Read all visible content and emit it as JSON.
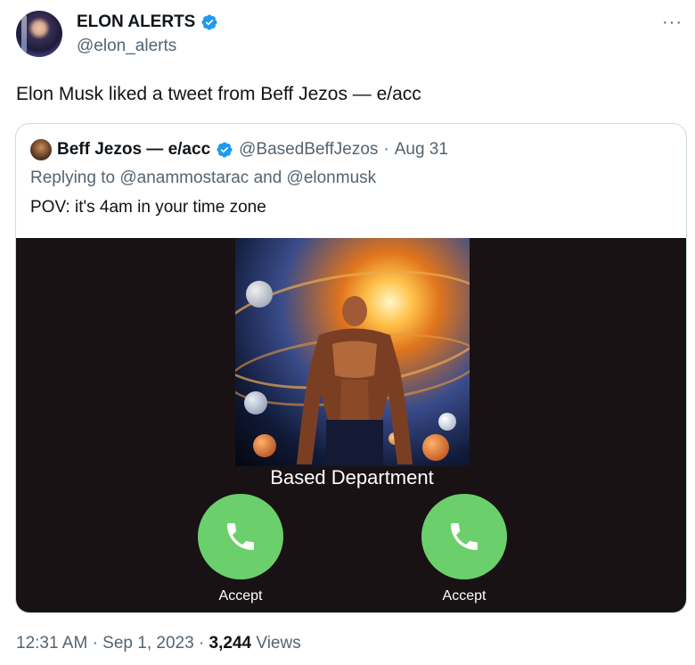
{
  "author": {
    "display_name": "ELON ALERTS",
    "handle": "@elon_alerts",
    "avatar_icon": "avatar-elon-icon"
  },
  "more_label": "···",
  "tweet_text": "Elon Musk liked a tweet from Beff Jezos — e/acc",
  "quoted": {
    "display_name": "Beff Jezos — e/acc",
    "handle": "@BasedBeffJezos",
    "separator": "·",
    "date": "Aug 31",
    "replying_to": "Replying to @anammostarac and @elonmusk",
    "text": "POV: it's 4am in your time zone",
    "media": {
      "caller_name": "Based Department",
      "accept_left": "Accept",
      "accept_right": "Accept"
    }
  },
  "meta": {
    "time": "12:31 AM",
    "dot1": "·",
    "date": "Sep 1, 2023",
    "dot2": "·",
    "views_count": "3,244",
    "views_label": "Views"
  },
  "colors": {
    "verified": "#1d9bf0",
    "accept_green": "#6bd06b",
    "secondary_text": "#536471"
  }
}
